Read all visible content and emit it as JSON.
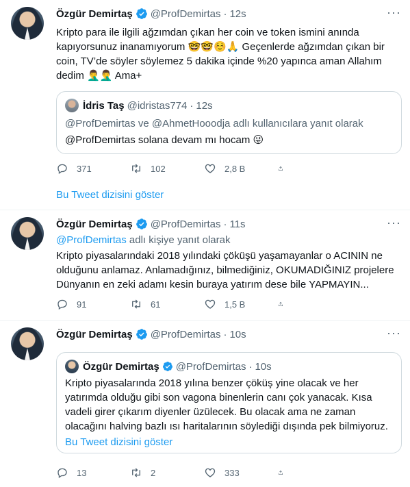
{
  "colors": {
    "accent": "#1d9bf0",
    "muted": "#536471",
    "text": "#0f1419",
    "border": "#cfd9de"
  },
  "tweets": [
    {
      "name": "Özgür Demirtaş",
      "handle": "@ProfDemirtas",
      "time": "12s",
      "text_lines": [
        "Kripto para ile ilgili ağzımdan çıkan her coin ve token ismini anında",
        "kapıyorsunuz inanamıyorum 🤓🤓☺️🙏 Geçenlerde ağzımdan çıkan bir",
        "coin, TV’de söyler söylemez 5 dakika içinde %20 yapınca aman Allahım",
        "dedim 🤦‍♂️🤦‍♂️ Ama+"
      ],
      "quote": {
        "name": "İdris Taş",
        "handle": "@idristas774",
        "time": "12s",
        "reply_to": "@ProfDemirtas ve @AhmetHooodja adlı kullanıcılara yanıt olarak",
        "text": "@ProfDemirtas solana devam mı hocam 😜"
      },
      "replies": "371",
      "retweets": "102",
      "likes": "2,8 B",
      "thread_link": "Bu Tweet dizisini göster"
    },
    {
      "name": "Özgür Demirtaş",
      "handle": "@ProfDemirtas",
      "time": "11s",
      "reply_to_mention": "@ProfDemirtas",
      "reply_to_suffix": " adlı kişiye yanıt olarak",
      "text_lines": [
        "Kripto piyasalarındaki 2018 yılındaki çöküşü yaşamayanlar o ACININ ne",
        "olduğunu anlamaz. Anlamadığınız, bilmediğiniz, OKUMADIĞINIZ projelere",
        "Dünyanın en zeki adamı kesin buraya yatırım dese bile YAPMAYIN..."
      ],
      "replies": "91",
      "retweets": "61",
      "likes": "1,5 B"
    },
    {
      "name": "Özgür Demirtaş",
      "handle": "@ProfDemirtas",
      "time": "10s",
      "quote": {
        "name": "Özgür Demirtaş",
        "handle": "@ProfDemirtas",
        "time": "10s",
        "text_lines": [
          "Kripto piyasalarında 2018 yılına benzer çöküş yine olacak ve her",
          "yatırımda olduğu gibi son vagona binenlerin canı çok yanacak. Kısa",
          "vadeli girer çıkarım diyenler üzülecek. Bu olacak ama ne zaman",
          "olacağını halving bazlı ısı haritalarının söylediği dışında pek bilmiyoruz."
        ],
        "thread_link": "Bu Tweet dizisini göster"
      },
      "replies": "13",
      "retweets": "2",
      "likes": "333"
    }
  ]
}
